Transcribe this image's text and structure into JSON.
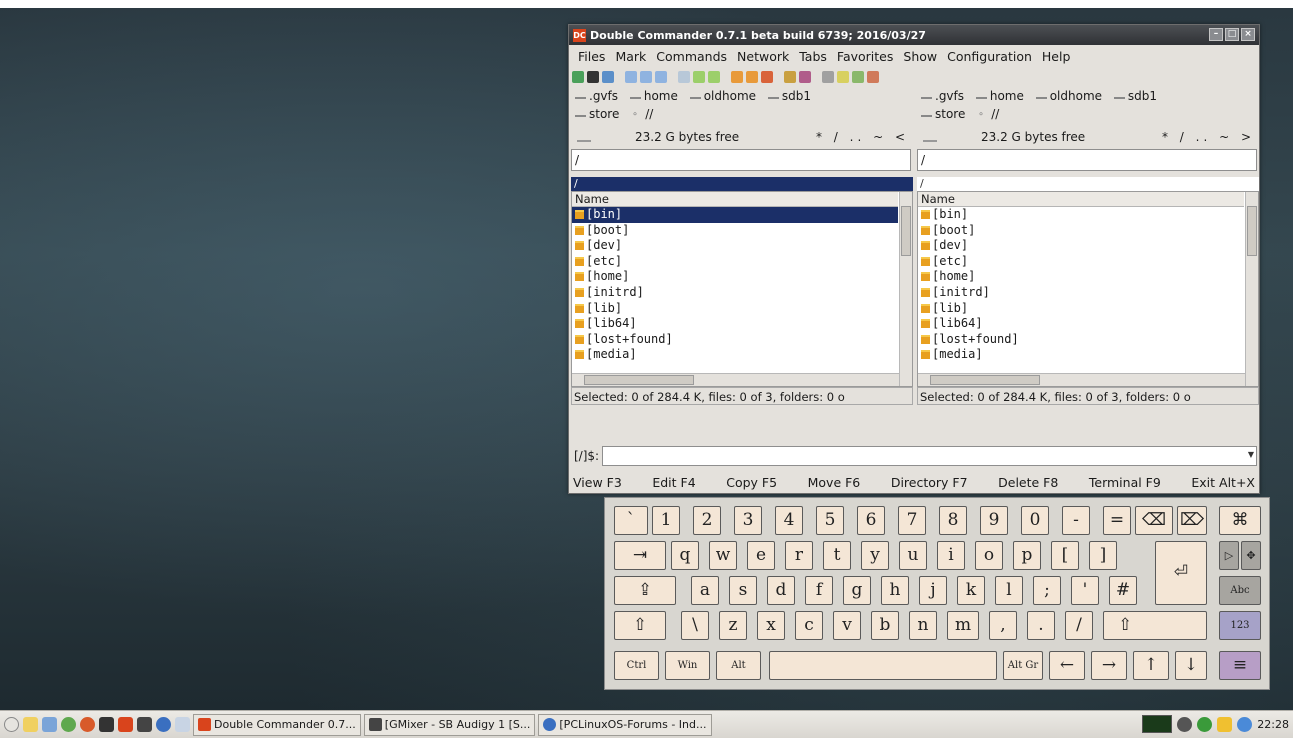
{
  "window": {
    "title": "Double Commander 0.7.1 beta build 6739; 2016/03/27",
    "menu": [
      "Files",
      "Mark",
      "Commands",
      "Network",
      "Tabs",
      "Favorites",
      "Show",
      "Configuration",
      "Help"
    ]
  },
  "drives": {
    "row1": [
      ".gvfs",
      "home",
      "oldhome",
      "sdb1"
    ],
    "row2": [
      "store",
      "//"
    ]
  },
  "left_pane": {
    "free_space": "23.2 G bytes free",
    "nav": "* / .. ~ <",
    "path_edit": "/",
    "header_path": "/",
    "column_name": "Name",
    "files": [
      "[bin]",
      "[boot]",
      "[dev]",
      "[etc]",
      "[home]",
      "[initrd]",
      "[lib]",
      "[lib64]",
      "[lost+found]",
      "[media]"
    ],
    "status": "Selected: 0 of 284.4 K, files: 0 of 3, folders: 0 o"
  },
  "right_pane": {
    "free_space": "23.2 G bytes free",
    "nav": "* / .. ~ >",
    "path_edit": "/",
    "header_path": "/",
    "column_name": "Name",
    "files": [
      "[bin]",
      "[boot]",
      "[dev]",
      "[etc]",
      "[home]",
      "[initrd]",
      "[lib]",
      "[lib64]",
      "[lost+found]",
      "[media]"
    ],
    "status": "Selected: 0 of 284.4 K, files: 0 of 3, folders: 0 o"
  },
  "command_line": {
    "prompt": "[/]$:",
    "value": ""
  },
  "function_keys": [
    "View F3",
    "Edit F4",
    "Copy F5",
    "Move F6",
    "Directory F7",
    "Delete F8",
    "Terminal F9",
    "Exit Alt+X"
  ],
  "keyboard": {
    "row1": [
      "`",
      "1",
      "2",
      "3",
      "4",
      "5",
      "6",
      "7",
      "8",
      "9",
      "0",
      "-",
      "="
    ],
    "row2": [
      "q",
      "w",
      "e",
      "r",
      "t",
      "y",
      "u",
      "i",
      "o",
      "p",
      "[",
      "]"
    ],
    "row3": [
      "a",
      "s",
      "d",
      "f",
      "g",
      "h",
      "j",
      "k",
      "l",
      ";",
      "'",
      "#"
    ],
    "row4": [
      "\\",
      "z",
      "x",
      "c",
      "v",
      "b",
      "n",
      "m",
      ",",
      ".",
      "/"
    ],
    "backspace": "⌫",
    "delete": "⌦",
    "close": "⌘",
    "tab": "⇥",
    "enter": "⏎",
    "caps": "⇪",
    "shift_left": "⇧",
    "shift_right": "⇧",
    "ctrl": "Ctrl",
    "win": "Win",
    "alt": "Alt",
    "altgr": "Alt Gr",
    "left": "←",
    "right": "→",
    "up": "↑",
    "down": "↓",
    "side_pin": "▷",
    "side_move": "✥",
    "side_abc": "Abc",
    "side_123": "123",
    "side_menu": "≡"
  },
  "taskbar": {
    "tasks": [
      "Double Commander 0.7...",
      "[GMixer - SB Audigy 1 [S...",
      "[PCLinuxOS-Forums - Ind..."
    ],
    "clock": "22:28"
  },
  "colors": {
    "selection": "#1b2f68",
    "title_bar": "#2f3135",
    "key_face": "#f4e6d6",
    "key_abc": "#a7a5a0",
    "key_123": "#a6a2c8",
    "key_menu": "#b79ec6"
  }
}
